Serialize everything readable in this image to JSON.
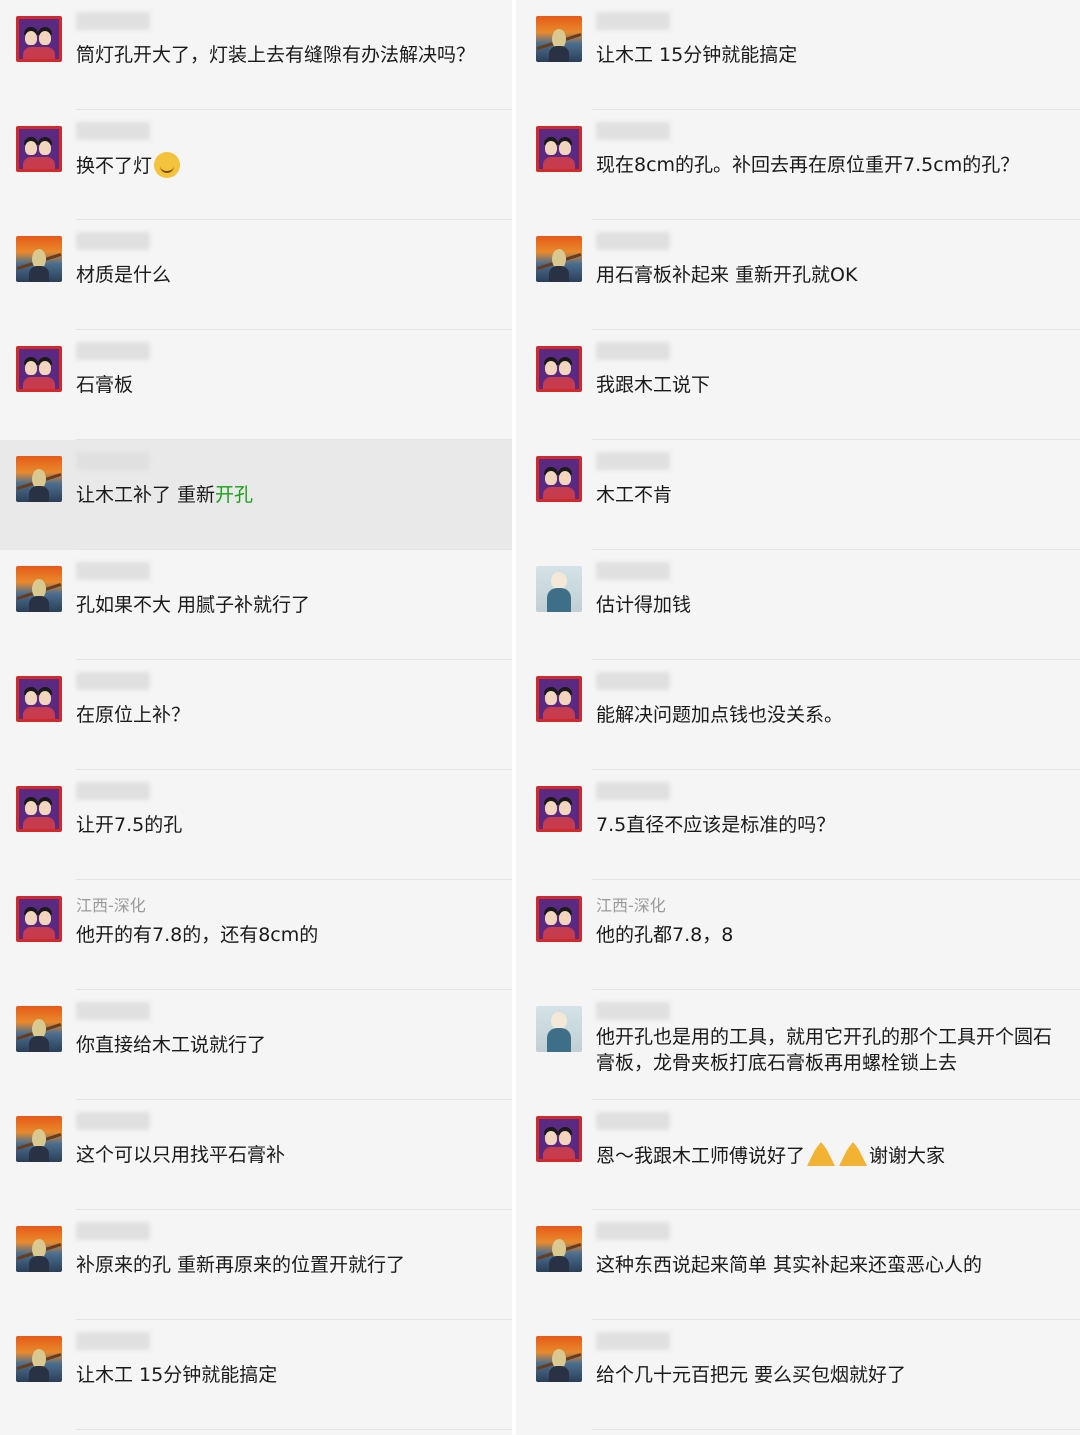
{
  "left_column": [
    {
      "avatar": "couple-avatar-icon",
      "name": "",
      "text": "筒灯孔开大了，灯装上去有缝隙有办法解决吗？"
    },
    {
      "avatar": "couple-avatar-icon",
      "name": "",
      "text": "换不了灯",
      "emoji": "crying-laughing-emoji-icon"
    },
    {
      "avatar": "scream-avatar-icon",
      "name": "",
      "text": "材质是什么"
    },
    {
      "avatar": "couple-avatar-icon",
      "name": "",
      "text": "石膏板"
    },
    {
      "avatar": "scream-avatar-icon",
      "name": "",
      "text": "让木工补了  重新",
      "highlight": "开孔",
      "selected": true
    },
    {
      "avatar": "scream-avatar-icon",
      "name": "",
      "text": "孔如果不大 用腻子补就行了"
    },
    {
      "avatar": "couple-avatar-icon",
      "name": "",
      "text": "在原位上补？"
    },
    {
      "avatar": "couple-avatar-icon",
      "name": "",
      "text": "让开7.5的孔"
    },
    {
      "avatar": "couple-avatar-icon",
      "name": "江西-深化",
      "text": "他开的有7.8的，还有8cm的"
    },
    {
      "avatar": "scream-avatar-icon",
      "name": "",
      "text": "你直接给木工说就行了"
    },
    {
      "avatar": "scream-avatar-icon",
      "name": "",
      "text": "这个可以只用找平石膏补"
    },
    {
      "avatar": "scream-avatar-icon",
      "name": "",
      "text": "补原来的孔 重新再原来的位置开就行了"
    },
    {
      "avatar": "scream-avatar-icon",
      "name": "",
      "text": "让木工 15分钟就能搞定"
    }
  ],
  "right_column": [
    {
      "avatar": "scream-avatar-icon",
      "name": "",
      "text": "让木工 15分钟就能搞定"
    },
    {
      "avatar": "couple-avatar-icon",
      "name": "",
      "text": "现在8cm的孔。补回去再在原位重开7.5cm的孔？"
    },
    {
      "avatar": "scream-avatar-icon",
      "name": "",
      "text": "用石膏板补起来  重新开孔就OK"
    },
    {
      "avatar": "couple-avatar-icon",
      "name": "",
      "text": "我跟木工说下"
    },
    {
      "avatar": "couple-avatar-icon",
      "name": "",
      "text": "木工不肯"
    },
    {
      "avatar": "child-avatar-icon",
      "name": "",
      "text": "估计得加钱"
    },
    {
      "avatar": "couple-avatar-icon",
      "name": "",
      "text": "能解决问题加点钱也没关系。"
    },
    {
      "avatar": "couple-avatar-icon",
      "name": "",
      "text": "7.5直径不应该是标准的吗？"
    },
    {
      "avatar": "couple-avatar-icon",
      "name": "江西-深化",
      "text": "他的孔都7.8，8"
    },
    {
      "avatar": "child-avatar-icon",
      "name": "",
      "text": "他开孔也是用的工具，就用它开孔的那个工具开个圆石膏板，龙骨夹板打底石膏板再用螺栓锁上去",
      "wrap": true
    },
    {
      "avatar": "couple-avatar-icon",
      "name": "",
      "text": "恩～我跟木工师傅说好了",
      "after": "谢谢大家",
      "pray": true
    },
    {
      "avatar": "scream-avatar-icon",
      "name": "",
      "text": "这种东西说起来简单 其实补起来还蛮恶心人的"
    },
    {
      "avatar": "scream-avatar-icon",
      "name": "",
      "text": "给个几十元百把元  要么买包烟就好了"
    }
  ],
  "colors": {
    "highlight": "#19a019",
    "background": "#f5f5f5",
    "selected": "#e9e9e9"
  }
}
